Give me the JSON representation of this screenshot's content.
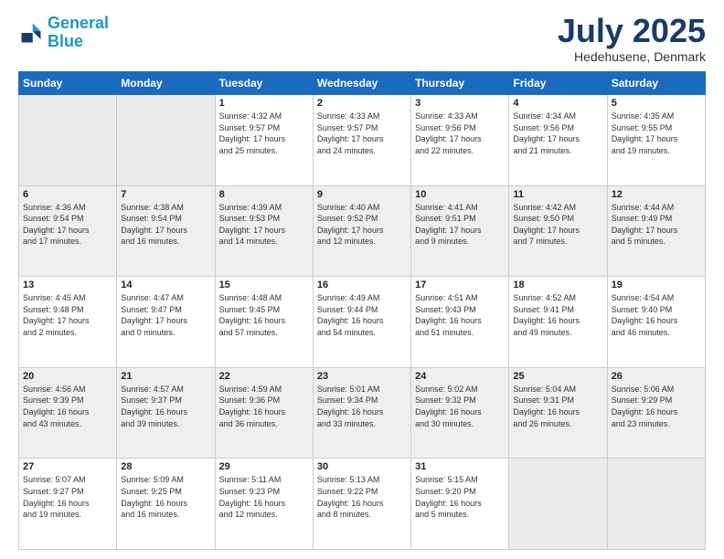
{
  "header": {
    "logo_line1": "General",
    "logo_line2": "Blue",
    "month": "July 2025",
    "location": "Hedehusene, Denmark"
  },
  "days_of_week": [
    "Sunday",
    "Monday",
    "Tuesday",
    "Wednesday",
    "Thursday",
    "Friday",
    "Saturday"
  ],
  "weeks": [
    [
      {
        "day": "",
        "info": ""
      },
      {
        "day": "",
        "info": ""
      },
      {
        "day": "1",
        "info": "Sunrise: 4:32 AM\nSunset: 9:57 PM\nDaylight: 17 hours\nand 25 minutes."
      },
      {
        "day": "2",
        "info": "Sunrise: 4:33 AM\nSunset: 9:57 PM\nDaylight: 17 hours\nand 24 minutes."
      },
      {
        "day": "3",
        "info": "Sunrise: 4:33 AM\nSunset: 9:56 PM\nDaylight: 17 hours\nand 22 minutes."
      },
      {
        "day": "4",
        "info": "Sunrise: 4:34 AM\nSunset: 9:56 PM\nDaylight: 17 hours\nand 21 minutes."
      },
      {
        "day": "5",
        "info": "Sunrise: 4:35 AM\nSunset: 9:55 PM\nDaylight: 17 hours\nand 19 minutes."
      }
    ],
    [
      {
        "day": "6",
        "info": "Sunrise: 4:36 AM\nSunset: 9:54 PM\nDaylight: 17 hours\nand 17 minutes."
      },
      {
        "day": "7",
        "info": "Sunrise: 4:38 AM\nSunset: 9:54 PM\nDaylight: 17 hours\nand 16 minutes."
      },
      {
        "day": "8",
        "info": "Sunrise: 4:39 AM\nSunset: 9:53 PM\nDaylight: 17 hours\nand 14 minutes."
      },
      {
        "day": "9",
        "info": "Sunrise: 4:40 AM\nSunset: 9:52 PM\nDaylight: 17 hours\nand 12 minutes."
      },
      {
        "day": "10",
        "info": "Sunrise: 4:41 AM\nSunset: 9:51 PM\nDaylight: 17 hours\nand 9 minutes."
      },
      {
        "day": "11",
        "info": "Sunrise: 4:42 AM\nSunset: 9:50 PM\nDaylight: 17 hours\nand 7 minutes."
      },
      {
        "day": "12",
        "info": "Sunrise: 4:44 AM\nSunset: 9:49 PM\nDaylight: 17 hours\nand 5 minutes."
      }
    ],
    [
      {
        "day": "13",
        "info": "Sunrise: 4:45 AM\nSunset: 9:48 PM\nDaylight: 17 hours\nand 2 minutes."
      },
      {
        "day": "14",
        "info": "Sunrise: 4:47 AM\nSunset: 9:47 PM\nDaylight: 17 hours\nand 0 minutes."
      },
      {
        "day": "15",
        "info": "Sunrise: 4:48 AM\nSunset: 9:45 PM\nDaylight: 16 hours\nand 57 minutes."
      },
      {
        "day": "16",
        "info": "Sunrise: 4:49 AM\nSunset: 9:44 PM\nDaylight: 16 hours\nand 54 minutes."
      },
      {
        "day": "17",
        "info": "Sunrise: 4:51 AM\nSunset: 9:43 PM\nDaylight: 16 hours\nand 51 minutes."
      },
      {
        "day": "18",
        "info": "Sunrise: 4:52 AM\nSunset: 9:41 PM\nDaylight: 16 hours\nand 49 minutes."
      },
      {
        "day": "19",
        "info": "Sunrise: 4:54 AM\nSunset: 9:40 PM\nDaylight: 16 hours\nand 46 minutes."
      }
    ],
    [
      {
        "day": "20",
        "info": "Sunrise: 4:56 AM\nSunset: 9:39 PM\nDaylight: 16 hours\nand 43 minutes."
      },
      {
        "day": "21",
        "info": "Sunrise: 4:57 AM\nSunset: 9:37 PM\nDaylight: 16 hours\nand 39 minutes."
      },
      {
        "day": "22",
        "info": "Sunrise: 4:59 AM\nSunset: 9:36 PM\nDaylight: 16 hours\nand 36 minutes."
      },
      {
        "day": "23",
        "info": "Sunrise: 5:01 AM\nSunset: 9:34 PM\nDaylight: 16 hours\nand 33 minutes."
      },
      {
        "day": "24",
        "info": "Sunrise: 5:02 AM\nSunset: 9:32 PM\nDaylight: 16 hours\nand 30 minutes."
      },
      {
        "day": "25",
        "info": "Sunrise: 5:04 AM\nSunset: 9:31 PM\nDaylight: 16 hours\nand 26 minutes."
      },
      {
        "day": "26",
        "info": "Sunrise: 5:06 AM\nSunset: 9:29 PM\nDaylight: 16 hours\nand 23 minutes."
      }
    ],
    [
      {
        "day": "27",
        "info": "Sunrise: 5:07 AM\nSunset: 9:27 PM\nDaylight: 16 hours\nand 19 minutes."
      },
      {
        "day": "28",
        "info": "Sunrise: 5:09 AM\nSunset: 9:25 PM\nDaylight: 16 hours\nand 16 minutes."
      },
      {
        "day": "29",
        "info": "Sunrise: 5:11 AM\nSunset: 9:23 PM\nDaylight: 16 hours\nand 12 minutes."
      },
      {
        "day": "30",
        "info": "Sunrise: 5:13 AM\nSunset: 9:22 PM\nDaylight: 16 hours\nand 8 minutes."
      },
      {
        "day": "31",
        "info": "Sunrise: 5:15 AM\nSunset: 9:20 PM\nDaylight: 16 hours\nand 5 minutes."
      },
      {
        "day": "",
        "info": ""
      },
      {
        "day": "",
        "info": ""
      }
    ]
  ]
}
